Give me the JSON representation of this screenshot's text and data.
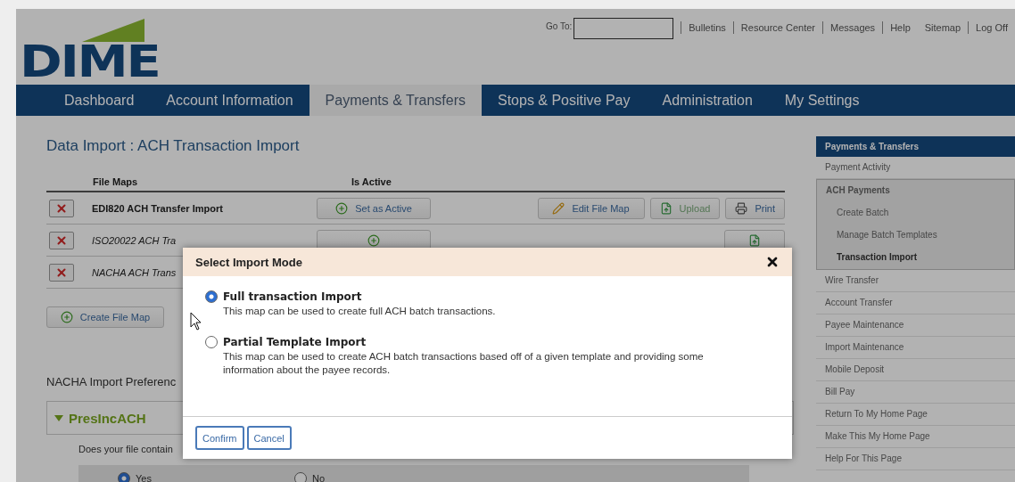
{
  "header": {
    "logo": "DIME",
    "goto_label": "Go To:",
    "links": [
      "Bulletins",
      "Resource Center",
      "Messages",
      "Help",
      "Sitemap",
      "Log Off"
    ]
  },
  "nav": [
    {
      "label": "Dashboard",
      "selected": false
    },
    {
      "label": "Account Information",
      "selected": false
    },
    {
      "label": "Payments & Transfers",
      "selected": true
    },
    {
      "label": "Stops & Positive Pay",
      "selected": false
    },
    {
      "label": "Administration",
      "selected": false
    },
    {
      "label": "My Settings",
      "selected": false
    }
  ],
  "page_title": "Data Import : ACH Transaction Import",
  "file_maps": {
    "columns": [
      "File Maps",
      "Is Active"
    ],
    "rows": [
      {
        "name": "EDI820 ACH Transfer Import",
        "active": true,
        "actions": [
          {
            "kind": "set_active",
            "label": "Set as Active"
          },
          {
            "kind": "edit",
            "label": "Edit File Map"
          },
          {
            "kind": "upload",
            "label": "Upload"
          },
          {
            "kind": "print",
            "label": "Print"
          }
        ]
      },
      {
        "name": "ISO20022 ACH Tra",
        "active": false,
        "actions": [
          {
            "kind": "set_active"
          },
          {
            "kind": "upload"
          }
        ]
      },
      {
        "name": "NACHA ACH Trans",
        "active": false,
        "actions": []
      }
    ]
  },
  "create_button": "Create File Map",
  "preferences": {
    "title": "NACHA Import Preferenc",
    "group": {
      "title": "PresIncACH",
      "expanded": true
    },
    "question": "Does your file contain",
    "options": [
      {
        "label": "Yes",
        "selected": true
      },
      {
        "label": "No",
        "selected": false
      }
    ]
  },
  "sidebar": {
    "title": "Payments & Transfers",
    "items": [
      {
        "label": "Payment Activity",
        "selected": false
      },
      {
        "label": "ACH Payments",
        "selected": false,
        "expanded": true,
        "children": [
          {
            "label": "Create Batch",
            "selected": false
          },
          {
            "label": "Manage Batch Templates",
            "selected": false
          },
          {
            "label": "Transaction Import",
            "selected": true
          }
        ]
      },
      {
        "label": "Wire Transfer",
        "selected": false
      },
      {
        "label": "Account Transfer",
        "selected": false
      },
      {
        "label": "Payee Maintenance",
        "selected": false
      },
      {
        "label": "Import Maintenance",
        "selected": false
      },
      {
        "label": "Mobile Deposit",
        "selected": false
      },
      {
        "label": "Bill Pay",
        "selected": false
      },
      {
        "label": "Return To My Home Page",
        "selected": false
      },
      {
        "label": "Make This My Home Page",
        "selected": false
      },
      {
        "label": "Help For This Page",
        "selected": false
      }
    ]
  },
  "modal": {
    "title": "Select Import Mode",
    "options": [
      {
        "title": "Full transaction Import",
        "description": "This map can be used to create full ACH batch transactions.",
        "selected": true
      },
      {
        "title": "Partial Template Import",
        "description": "This map can be used to create ACH batch transactions based off of a given template and providing some information about the payee records.",
        "selected": false
      }
    ],
    "buttons": [
      "Confirm",
      "Cancel"
    ]
  }
}
